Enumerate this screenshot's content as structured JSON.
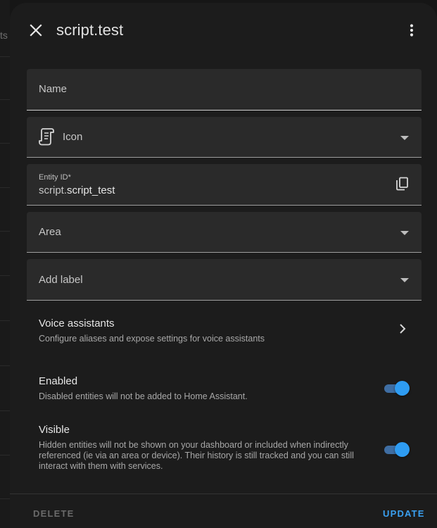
{
  "background": {
    "truncated_text": "ts"
  },
  "dialog": {
    "title": "script.test",
    "close_icon": "close-icon",
    "menu_icon": "more-vertical-icon"
  },
  "fields": {
    "name": {
      "label": "Name",
      "value": ""
    },
    "icon": {
      "label": "Icon",
      "icon": "script-text-icon"
    },
    "entity_id": {
      "label": "Entity ID*",
      "prefix": "script.",
      "value": "script_test",
      "action_icon": "copy-icon"
    },
    "area": {
      "label": "Area"
    },
    "add_label": {
      "label": "Add label"
    }
  },
  "voice_assistants": {
    "title": "Voice assistants",
    "description": "Configure aliases and expose settings for voice assistants",
    "icon": "chevron-right-icon"
  },
  "enabled": {
    "title": "Enabled",
    "description": "Disabled entities will not be added to Home Assistant.",
    "on": true
  },
  "visible": {
    "title": "Visible",
    "description": "Hidden entities will not be shown on your dashboard or included when indirectly referenced (ie via an area or device). Their history is still tracked and you can still interact with them with services.",
    "on": true
  },
  "footer": {
    "delete_label": "DELETE",
    "update_label": "UPDATE"
  },
  "colors": {
    "accent": "#3aa0f0",
    "toggle_knob": "#2e9cf2",
    "toggle_track": "#3f6ea3",
    "dialog_bg": "#1c1c1c",
    "field_bg": "#2a2a2a"
  }
}
